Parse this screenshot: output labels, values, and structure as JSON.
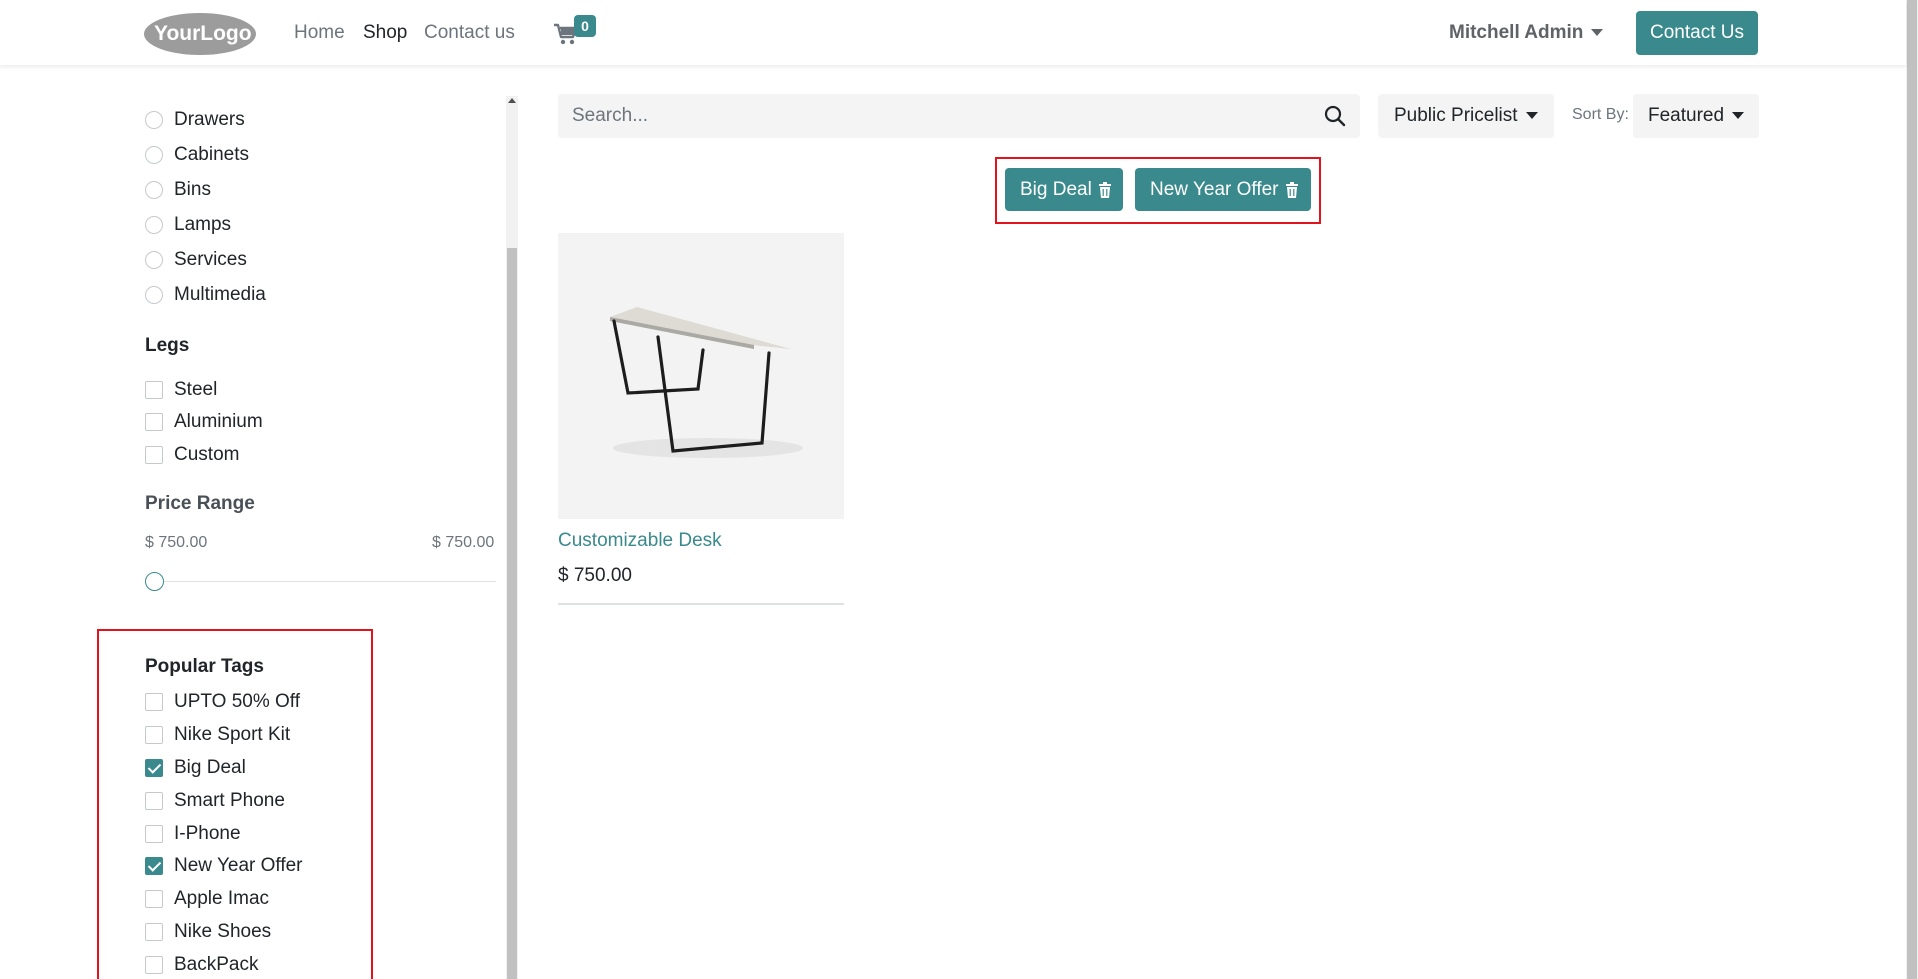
{
  "header": {
    "logo_text": "YourLogo",
    "nav": [
      {
        "label": "Home",
        "active": false
      },
      {
        "label": "Shop",
        "active": true
      },
      {
        "label": "Contact us",
        "active": false
      }
    ],
    "cart_count": "0",
    "user_name": "Mitchell Admin",
    "contact_button": "Contact Us"
  },
  "sidebar": {
    "categories": [
      "Drawers",
      "Cabinets",
      "Bins",
      "Lamps",
      "Services",
      "Multimedia"
    ],
    "legs": {
      "title": "Legs",
      "options": [
        "Steel",
        "Aluminium",
        "Custom"
      ]
    },
    "price_range": {
      "title": "Price Range",
      "min_label": "$ 750.00",
      "max_label": "$ 750.00"
    },
    "popular_tags": {
      "title": "Popular Tags",
      "tags": [
        {
          "label": "UPTO 50% Off",
          "checked": false
        },
        {
          "label": "Nike Sport Kit",
          "checked": false
        },
        {
          "label": "Big Deal",
          "checked": true
        },
        {
          "label": "Smart Phone",
          "checked": false
        },
        {
          "label": "I-Phone",
          "checked": false
        },
        {
          "label": "New Year Offer",
          "checked": true
        },
        {
          "label": "Apple Imac",
          "checked": false
        },
        {
          "label": "Nike Shoes",
          "checked": false
        },
        {
          "label": "BackPack",
          "checked": false
        }
      ]
    }
  },
  "main": {
    "search_placeholder": "Search...",
    "pricelist": "Public Pricelist",
    "sort_label": "Sort By:",
    "sort_value": "Featured",
    "active_filters": [
      "Big Deal",
      "New Year Offer"
    ],
    "products": [
      {
        "name": "Customizable Desk",
        "price": "$ 750.00"
      }
    ]
  },
  "colors": {
    "accent": "#3a8a8d",
    "highlight_box": "#e3131e"
  }
}
